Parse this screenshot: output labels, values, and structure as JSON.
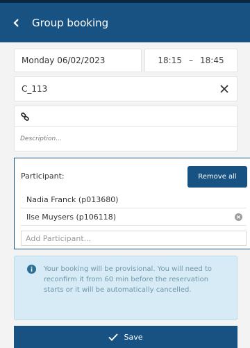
{
  "header": {
    "title": "Group booking",
    "back_icon": "chevron-left-icon"
  },
  "booking": {
    "date": "Monday 06/02/2023",
    "start_time": "18:15",
    "time_separator": "–",
    "end_time": "18:45",
    "room": "C_113",
    "description_placeholder": "Description..."
  },
  "participants": {
    "label": "Participant:",
    "remove_all_label": "Remove all",
    "items": [
      {
        "name": "Nadia Franck (p013680)"
      },
      {
        "name": "Ilse Muysers (p106118)"
      }
    ],
    "add_placeholder": "Add Participant..."
  },
  "notice": {
    "text": "Your booking will be provisional. You will need to reconfirm it from 60 min before the reservation starts or it will be automatically cancelled."
  },
  "save": {
    "label": "Save",
    "icon": "checkmark-icon"
  },
  "colors": {
    "primary": "#175282",
    "header_top_border": "#0b2740",
    "info_background": "#d6ebf5",
    "info_text": "#6f97ab"
  }
}
